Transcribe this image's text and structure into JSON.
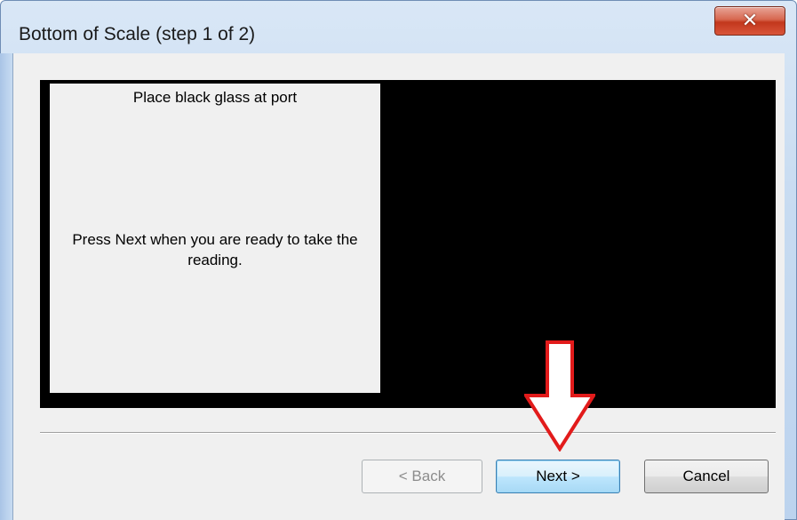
{
  "window": {
    "title": "Bottom of Scale (step 1 of 2)",
    "close_glyph": "✕"
  },
  "instructions": {
    "line1": "Place black glass at port",
    "line2": "Press Next when you are ready to take the reading."
  },
  "buttons": {
    "back_label": "< Back",
    "next_label": "Next >",
    "cancel_label": "Cancel"
  },
  "annotation": {
    "arrow_color": "#e21b1b",
    "arrow_icon": "down-arrow-icon"
  }
}
